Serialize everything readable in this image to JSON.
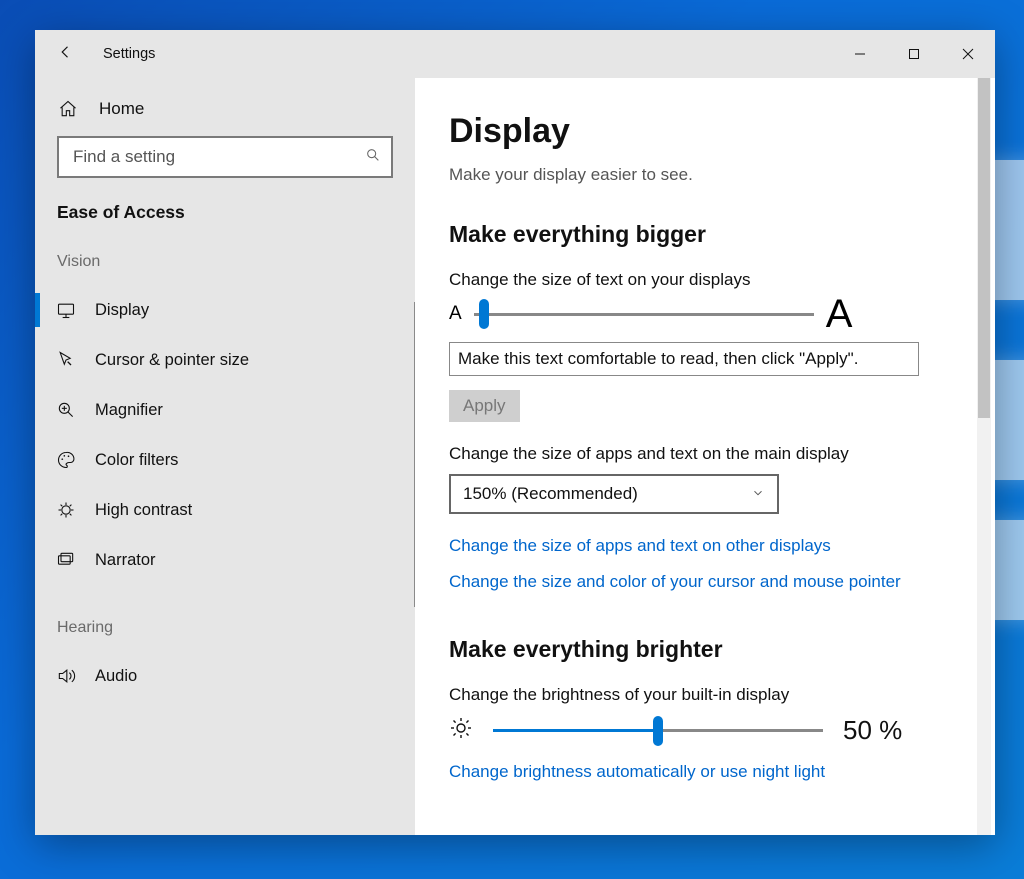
{
  "window": {
    "title": "Settings"
  },
  "sidebar": {
    "home": "Home",
    "search_placeholder": "Find a setting",
    "category": "Ease of Access",
    "groups": [
      {
        "label": "Vision",
        "items": [
          {
            "icon": "display-icon",
            "label": "Display",
            "active": true
          },
          {
            "icon": "cursor-icon",
            "label": "Cursor & pointer size"
          },
          {
            "icon": "magnifier-icon",
            "label": "Magnifier"
          },
          {
            "icon": "palette-icon",
            "label": "Color filters"
          },
          {
            "icon": "contrast-icon",
            "label": "High contrast"
          },
          {
            "icon": "narrator-icon",
            "label": "Narrator"
          }
        ]
      },
      {
        "label": "Hearing",
        "items": [
          {
            "icon": "audio-icon",
            "label": "Audio"
          }
        ]
      }
    ]
  },
  "content": {
    "title": "Display",
    "subtitle": "Make your display easier to see.",
    "section1": {
      "heading": "Make everything bigger",
      "text_size_label": "Change the size of text on your displays",
      "smallA": "A",
      "bigA": "A",
      "text_slider_pct": 3,
      "sample_text": "Make this text comfortable to read, then click \"Apply\".",
      "apply_label": "Apply",
      "apps_label": "Change the size of apps and text on the main display",
      "apps_select": "150% (Recommended)",
      "link_other": "Change the size of apps and text on other displays",
      "link_cursor": "Change the size and color of your cursor and mouse pointer"
    },
    "section2": {
      "heading": "Make everything brighter",
      "bright_label": "Change the brightness of your built-in display",
      "bright_pct": 50,
      "bright_value": "50 %",
      "link_auto": "Change brightness automatically or use night light"
    }
  }
}
